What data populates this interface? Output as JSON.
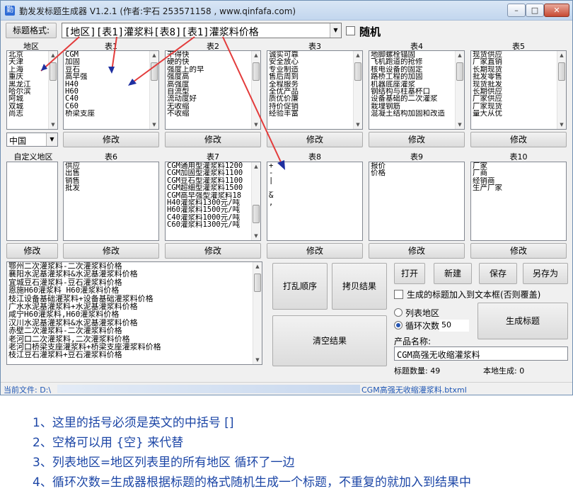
{
  "window": {
    "title": "勤发发标题生成器 V1.2.1 (作者:宇石 253571158 , www.qinfafa.com)",
    "min": "–",
    "max": "□",
    "close": "✕"
  },
  "format": {
    "label": "标题格式:",
    "value": "[地区][表1]灌浆料[表8][表1]灌浆料价格",
    "random_label": "随机"
  },
  "lists": {
    "region": {
      "label": "地区",
      "items": [
        "北京",
        "天津",
        "上海",
        "重庆",
        "黑龙江",
        "哈尔滨",
        "阿城",
        "双城",
        "尚志"
      ],
      "combo": "中国",
      "button": "修改"
    },
    "t1": {
      "label": "表1",
      "items": [
        "CGM",
        "加固",
        "豆石",
        "高早强",
        "H40",
        "H60",
        "C40",
        "C60",
        "桥梁支座"
      ],
      "button": "修改"
    },
    "t2": {
      "label": "表2",
      "items": [
        "干得快",
        "硬的快",
        "强度上的早",
        "强度高",
        "高强度",
        "自流型",
        "流动度好",
        "无收缩",
        "不收缩"
      ],
      "button": "修改"
    },
    "t3": {
      "label": "表3",
      "items": [
        "诚实可靠",
        "安全放心",
        "专业制造",
        "售后周到",
        "全程服务",
        "全优产品",
        "质优价廉",
        "持价促销",
        "经验丰富"
      ],
      "button": "修改"
    },
    "t4": {
      "label": "表4",
      "items": [
        "地脚螺栓锚固",
        "飞机跑道的抢修",
        "核电设备的固定",
        "路桥工程的加固",
        "机器底座灌浆",
        "钢结构与柱基杯口",
        "设备基础的二次灌浆",
        "栽埋钢筋",
        "混凝土结构加固和改造"
      ],
      "button": "修改"
    },
    "t5": {
      "label": "表5",
      "items": [
        "现货供应",
        "厂家直销",
        "长期现货",
        "批发零售",
        "现货批发",
        "长期供应",
        "厂家供应",
        "厂家现货",
        "量大从优"
      ],
      "button": "修改"
    },
    "custom": {
      "label": "自定义地区",
      "items": [],
      "button": "修改"
    },
    "t6": {
      "label": "表6",
      "items": [
        "供应",
        "出售",
        "销售",
        "批发"
      ],
      "button": "修改"
    },
    "t7": {
      "label": "表7",
      "items": [
        "CGM通用型灌浆料1200",
        "CGM加固型灌浆料1100",
        "CGM豆石型灌浆料1100",
        "CGM超细型灌浆料1500",
        "CGM高早强型灌浆料18",
        "H40灌浆料1300元/吨",
        "H60灌浆料1500元/吨",
        "C40灌浆料1000元/吨",
        "C60灌浆料1300元/吨"
      ],
      "button": "修改"
    },
    "t8": {
      "label": "表8",
      "items": [
        "+",
        "-",
        "|",
        "_",
        "&",
        ","
      ],
      "button": "修改"
    },
    "t9": {
      "label": "表9",
      "items": [
        "报价",
        "价格"
      ],
      "button": "修改"
    },
    "t10": {
      "label": "表10",
      "items": [
        "厂家",
        "厂商",
        "经销商",
        "生产厂家"
      ],
      "button": "修改"
    }
  },
  "results": {
    "items": [
      "鄂州二次灌浆料-二次灌浆料价格",
      "襄阳水泥基灌浆料&水泥基灌浆料价格",
      "宜城豆石灌浆料-豆石灌浆料价格",
      "恩施H60灌浆料_H60灌浆料价格",
      "枝江设备基础灌浆料+设备基础灌浆料价格",
      "广水水泥基灌浆料+水泥基灌浆料价格",
      "咸宁H60灌浆料,H60灌浆料价格",
      "汉川水泥基灌浆料&水泥基灌浆料价格",
      "赤壁二次灌浆料-二次灌浆料价格",
      "老河口二次灌浆料,二次灌浆料价格",
      "老河口桥梁支座灌浆料+桥梁支座灌浆料价格",
      "枝江豆石灌浆料+豆石灌浆料价格"
    ]
  },
  "actions": {
    "shuffle": "打乱顺序",
    "copy": "拷贝结果",
    "clear": "清空结果",
    "open": "打开",
    "new": "新建",
    "save": "保存",
    "saveas": "另存为",
    "generate": "生成标题"
  },
  "options": {
    "append_label": "生成的标题加入到文本框(否则覆盖)",
    "list_region": "列表地区",
    "loop_label": "循环次数",
    "loop_value": "50",
    "product_label": "产品名称:",
    "product_value": "CGM高强无收缩灌浆料",
    "count_label": "标题数量: 49",
    "local_label": "本地生成: 0"
  },
  "status": {
    "prefix": "当前文件: D:\\",
    "file": "CGM高强无收缩灌浆料.btxml"
  },
  "notes": [
    "1、这里的括号必须是英文的中括号 []",
    "2、空格可以用 {空} 来代替",
    "3、列表地区=地区列表里的所有地区 循环了一边",
    "4、循环次数=生成器根据标题的格式随机生成一个标题，不重复的就加入到结果中"
  ],
  "colors": {
    "arrow": "#e33b3b",
    "arrow_head": "#1f2fa0",
    "note_text": "#1c46a6",
    "status_text": "#1e56b4"
  }
}
